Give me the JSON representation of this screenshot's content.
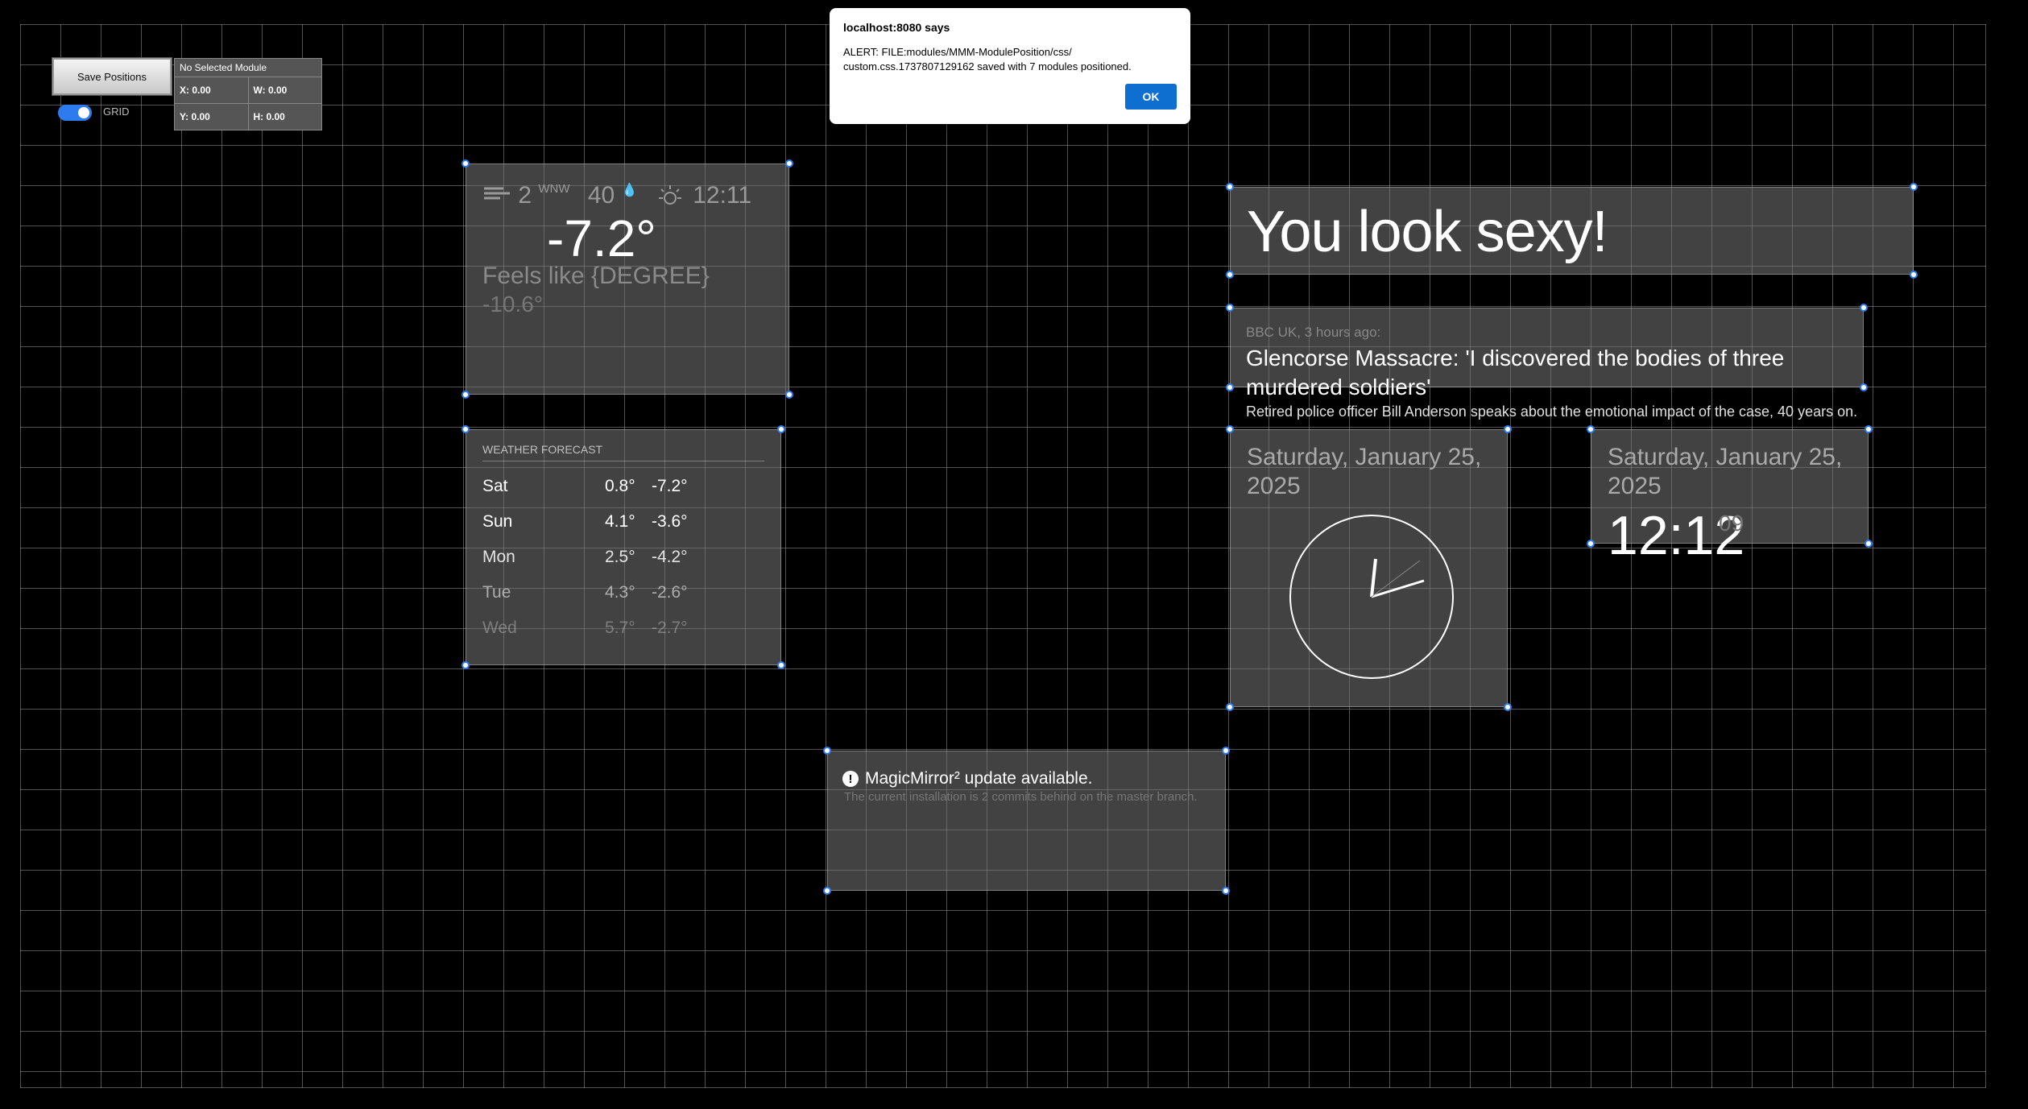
{
  "controls": {
    "save_label": "Save Positions",
    "info_title": "No Selected Module",
    "x_label": "X: 0.00",
    "y_label": "Y: 0.00",
    "w_label": "W: 0.00",
    "h_label": "H: 0.00",
    "grid_label": "GRID",
    "grid_on": true
  },
  "alert": {
    "title": "localhost:8080 says",
    "message": "ALERT: FILE:modules/MMM-ModulePosition/css/ custom.css.1737807129162 saved with 7 modules positioned.",
    "ok_label": "OK"
  },
  "weather": {
    "wind_speed": "2",
    "wind_dir": "WNW",
    "humidity": "40",
    "sunrise_time": "12:11",
    "temperature": "-7.2°",
    "feels_like": "Feels like {DEGREE}",
    "feels_value": "-10.6°",
    "icons": [
      "wind-icon",
      "humidity-icon",
      "sun-icon"
    ]
  },
  "forecast": {
    "header": "WEATHER FORECAST",
    "days": [
      {
        "day": "Sat",
        "high": "0.8°",
        "low": "-7.2°"
      },
      {
        "day": "Sun",
        "high": "4.1°",
        "low": "-3.6°"
      },
      {
        "day": "Mon",
        "high": "2.5°",
        "low": "-4.2°"
      },
      {
        "day": "Tue",
        "high": "4.3°",
        "low": "-2.6°"
      },
      {
        "day": "Wed",
        "high": "5.7°",
        "low": "-2.7°"
      }
    ]
  },
  "compliments": {
    "text": "You look sexy!"
  },
  "news": {
    "source": "BBC UK, 3 hours ago:",
    "title": "Glencorse Massacre: 'I discovered the bodies of three murdered soldiers'",
    "description": "Retired police officer Bill Anderson speaks about the emotional impact of the case, 40 years on."
  },
  "clock_analog": {
    "date": "Saturday, January 25, 2025"
  },
  "clock_digital": {
    "date": "Saturday, January 25, 2025",
    "time": "12:12",
    "seconds": "09"
  },
  "update": {
    "title": "MagicMirror² update available.",
    "subtitle": "The current installation is 2 commits behind on the master branch."
  }
}
